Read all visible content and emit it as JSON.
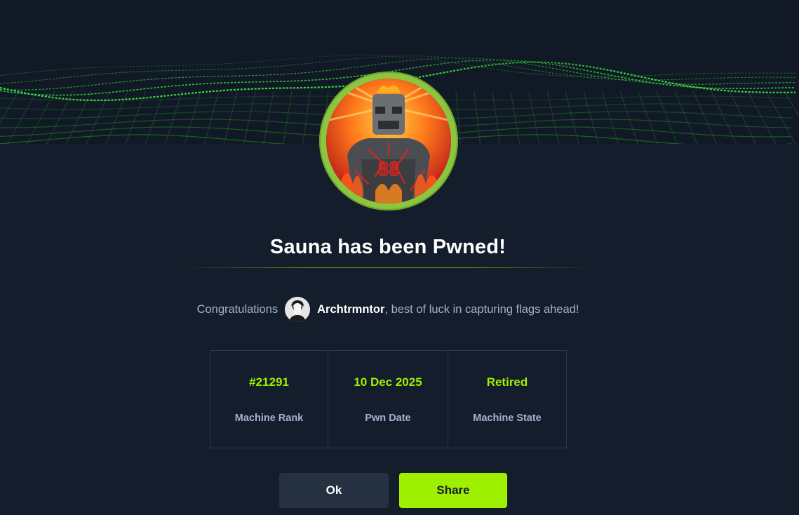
{
  "modal": {
    "title": "Sauna has been Pwned!",
    "congrats_prefix": "Congratulations",
    "username": "Archtrmntor",
    "congrats_suffix": ", best of luck in capturing flags ahead!",
    "stats": [
      {
        "value": "#21291",
        "label": "Machine Rank"
      },
      {
        "value": "10 Dec 2025",
        "label": "Pwn Date"
      },
      {
        "value": "Retired",
        "label": "Machine State"
      }
    ],
    "buttons": {
      "ok_label": "Ok",
      "share_label": "Share"
    }
  },
  "colors": {
    "background": "#141d2b",
    "accent_green": "#9fef00",
    "muted_text": "#a4b1cd",
    "ok_button": "#253040",
    "avatar_ring": "#8cc63f"
  },
  "icons": {
    "machine_avatar": "sauna-machine-avatar",
    "user_avatar": "user-avatar"
  }
}
